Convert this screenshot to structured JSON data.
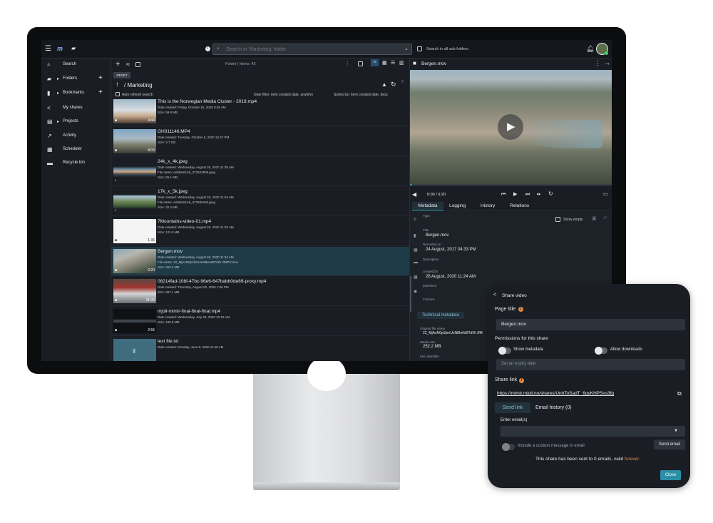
{
  "app": {
    "search_placeholder": "Search in 'Marketing' folder",
    "search_subfolders": "Search in all sub folders"
  },
  "sidebar": {
    "items": [
      {
        "label": "Search"
      },
      {
        "label": "Folders"
      },
      {
        "label": "Bookmarks"
      },
      {
        "label": "My shares"
      },
      {
        "label": "Projects"
      },
      {
        "label": "Activity"
      },
      {
        "label": "Scheduler"
      },
      {
        "label": "Recycle bin"
      }
    ]
  },
  "folder": {
    "reset_label": "RESET",
    "summary": "Folder | Items: 42",
    "path": "/ Marketing",
    "auto_refresh": "Auto refresh search",
    "date_filter": "Date filter: item created date, anytime",
    "sorted_by": "Sorted by: item created date, desc"
  },
  "items": [
    {
      "name": "This is the Norwegian Media Cluster - 2019.mp4",
      "line1": "Date created: Friday, October 16, 2020 8:45 AM",
      "line2": "Size: 59.8 MB",
      "line3": "",
      "duration": "4:44"
    },
    {
      "name": "GH011146.MP4",
      "line1": "Date created: Tuesday, October 6, 2020 12:47 PM",
      "line2": "Size: 3.7 GB",
      "line3": "",
      "duration": "8:03"
    },
    {
      "name": "24k_x_4k.jpeg",
      "line1": "Date created: Wednesday, August 26, 2020 11:35 AM",
      "line2": "File name: AdobeStock_372522805.jpeg",
      "line3": "Size: 26.1 MB",
      "duration": ""
    },
    {
      "name": "17k_x_5k.jpeg",
      "line1": "Date created: Wednesday, August 26, 2020 11:34 AM",
      "line2": "File name: AdobeStock_373526440.jpeg",
      "line3": "Size: 32.2 MB",
      "duration": ""
    },
    {
      "name": "7Mountains-video-01.mp4",
      "line1": "Date created: Wednesday, August 26, 2020 11:25 AM",
      "line2": "Size: 121.9 MB",
      "line3": "",
      "duration": "1:36"
    },
    {
      "name": "Bergen.mov",
      "line1": "Date created: Wednesday, August 26, 2020 11:24 AM",
      "line2": "File name: 22_MjAxN0p1bmUxNiBwNi9TdW JfMDY.mov",
      "line3": "Size: 252.2 MB",
      "duration": "0:20"
    },
    {
      "name": "08214fad-108f-47bc-96e6-647babb0de89-proxy.mp4",
      "line1": "Date created: Thursday, August 20, 2020 1:06 PM",
      "line2": "Size: 867.1 MB",
      "line3": "",
      "duration": "31:00"
    },
    {
      "name": "mjoll-mimir-final-final-final.mp4",
      "line1": "Date created: Wednesday, July 29, 2020 10:19 AM",
      "line2": "Size: 190.5 MB",
      "line3": "",
      "duration": "2:55"
    },
    {
      "name": "text file.txt",
      "line1": "Date created: Monday, June 8, 2020 11:45 AM",
      "line2": "",
      "line3": "",
      "duration": ""
    }
  ],
  "viewer": {
    "title": "Bergen.mov",
    "time": "0:00 / 0:20",
    "tabs": [
      "Metadata",
      "Logging",
      "History",
      "Relations"
    ],
    "show_empty": "Show empty",
    "metadata": {
      "type_label": "Type",
      "title_label": "Title",
      "title_value": "Bergen.mov",
      "recorded_label": "Recorded on",
      "recorded_value": "24 August, 2017 04:33 PM",
      "description_label": "Description",
      "created_label": "createdOn",
      "created_value": "26 August, 2020 11:24 AM",
      "published_label": "published",
      "mchoice_label": "mchoice",
      "technical_label": "Technical metadata",
      "original_label": "Original file name",
      "original_value": "22_MjAxN0p1bmUxNiBwNi9TdW JfM",
      "media_size_label": "Media size",
      "media_size_value": "252.2 MB",
      "item_identifier_label": "Item identifier"
    }
  },
  "share": {
    "header": "Share video",
    "page_title_label": "Page title",
    "page_title_value": "Bergen.mov",
    "permissions_label": "Permissions for this share",
    "show_metadata": "Show metadata",
    "allow_downloads": "Allow downloads",
    "expiry_placeholder": "Set an expiry date",
    "share_link_label": "Share link",
    "share_link": "https://mimir.mjoll.no/shares/UnhToSadT_6gvKHPSvs3fg",
    "tab_send": "Send link",
    "tab_history": "Email history (0)",
    "enter_emails": "Enter email(s)",
    "custom_message": "Include a custom message in email",
    "send_email": "Send email",
    "status_prefix": "This share has been sent to 0 emails, valid",
    "status_highlight": "forever.",
    "close": "Close"
  },
  "colors": {
    "accent": "#2a8fa6",
    "selected_row": "#1e3a47",
    "warning": "#e08a3c",
    "screen_bg": "#1a1e24"
  }
}
